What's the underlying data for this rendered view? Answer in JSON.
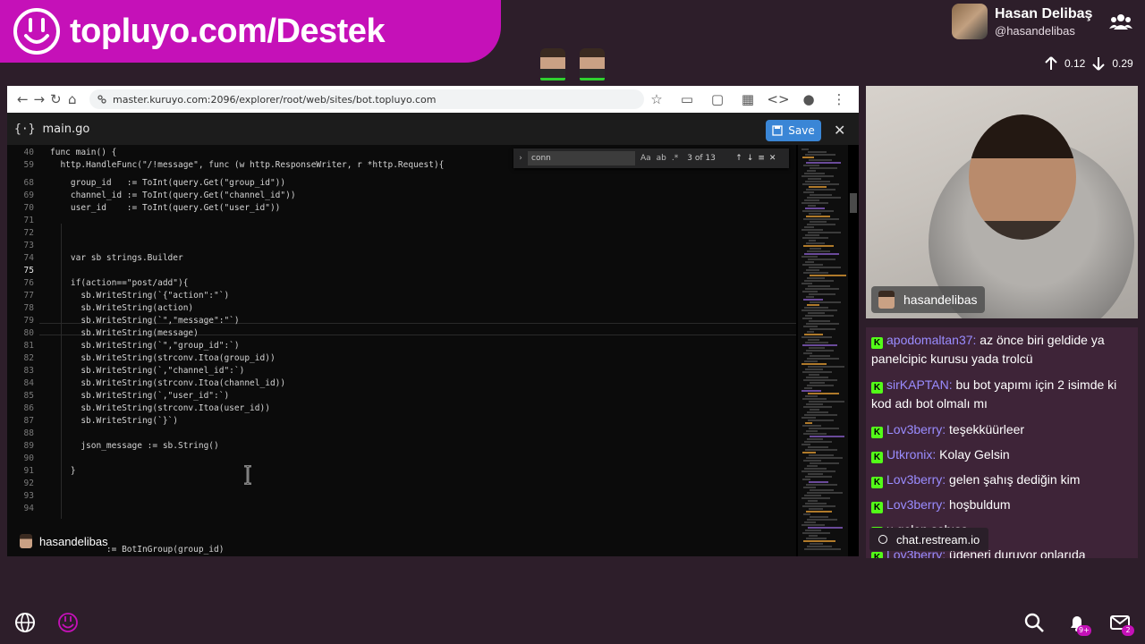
{
  "banner": {
    "text": "topluyo.com/Destek"
  },
  "profile": {
    "name": "Hasan Delibaş",
    "handle": "@hasandelibas",
    "up": "0.12",
    "down": "0.29"
  },
  "browser": {
    "url": "master.kuruyo.com:2096/explorer/root/web/sites/bot.topluyo.com"
  },
  "editor": {
    "filename": "main.go",
    "save_label": "Save",
    "find": {
      "query": "conn",
      "count": "3 of 13",
      "opt_case": "Aa",
      "opt_word": "ab",
      "opt_regex": ".*"
    },
    "lines": [
      {
        "n": "40",
        "t": "func main() {"
      },
      {
        "n": "59",
        "t": "  http.HandleFunc(\"/!message\", func (w http.ResponseWriter, r *http.Request){"
      },
      {
        "n": "68",
        "t": "    group_id   := ToInt(query.Get(\"group_id\"))"
      },
      {
        "n": "69",
        "t": "    channel_id := ToInt(query.Get(\"channel_id\"))"
      },
      {
        "n": "70",
        "t": "    user_id    := ToInt(query.Get(\"user_id\"))"
      },
      {
        "n": "71",
        "t": ""
      },
      {
        "n": "72",
        "t": ""
      },
      {
        "n": "73",
        "t": ""
      },
      {
        "n": "74",
        "t": "    var sb strings.Builder"
      },
      {
        "n": "75",
        "t": ""
      },
      {
        "n": "76",
        "t": "    if(action==\"post/add\"){"
      },
      {
        "n": "77",
        "t": "      sb.WriteString(`{\"action\":\"`)"
      },
      {
        "n": "78",
        "t": "      sb.WriteString(action)"
      },
      {
        "n": "79",
        "t": "      sb.WriteString(`\",\"message\":\"`)"
      },
      {
        "n": "80",
        "t": "      sb.WriteString(message)"
      },
      {
        "n": "81",
        "t": "      sb.WriteString(`\",\"group_id\":`)"
      },
      {
        "n": "82",
        "t": "      sb.WriteString(strconv.Itoa(group_id))"
      },
      {
        "n": "83",
        "t": "      sb.WriteString(`,\"channel_id\":`)"
      },
      {
        "n": "84",
        "t": "      sb.WriteString(strconv.Itoa(channel_id))"
      },
      {
        "n": "85",
        "t": "      sb.WriteString(`,\"user_id\":`)"
      },
      {
        "n": "86",
        "t": "      sb.WriteString(strconv.Itoa(user_id))"
      },
      {
        "n": "87",
        "t": "      sb.WriteString(`}`)"
      },
      {
        "n": "88",
        "t": ""
      },
      {
        "n": "89",
        "t": "      json_message := sb.String()"
      },
      {
        "n": "90",
        "t": ""
      },
      {
        "n": "91",
        "t": "    }"
      },
      {
        "n": "92",
        "t": ""
      },
      {
        "n": "93",
        "t": ""
      },
      {
        "n": "94",
        "t": ""
      },
      {
        "n": "",
        "t": "           := BotInGroup(group_id)"
      }
    ]
  },
  "screen_tag": "hasandelibas",
  "cam_tag": "hasandelibas",
  "chat": {
    "messages": [
      {
        "user": "apodomaltan37:",
        "text": " az önce biri geldide ya panelcipic kurusu yada trolcü"
      },
      {
        "user": "sirKAPTAN:",
        "text": " bu bot yapımı için 2 isimde ki kod adı bot olmalı mı"
      },
      {
        "user": "Lov3berry:",
        "text": " teşekküürleer"
      },
      {
        "user": "Utkronix:",
        "text": " Kolay Gelsin"
      },
      {
        "user": "Lov3berry:",
        "text": " gelen şahış dediğin kim"
      },
      {
        "user": "Lov3berry:",
        "text": " hoşbuldum"
      },
      {
        "user": "",
        "text": "u gelen şahısa"
      },
      {
        "user": "Lov3berry:",
        "text": " üdeneri duruyor onlarıda"
      }
    ],
    "source": "chat.restream.io"
  },
  "bottom": {
    "bell_badge": "9+",
    "mail_badge": "2"
  }
}
